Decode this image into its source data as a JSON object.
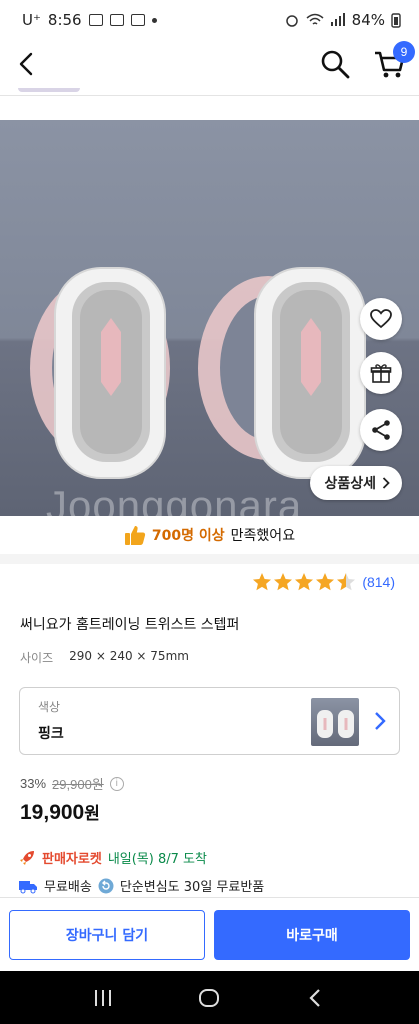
{
  "status_bar": {
    "carrier": "U⁺",
    "time": "8:56",
    "battery": "84%"
  },
  "nav": {
    "cart_count": "9"
  },
  "product_image": {
    "watermark": "Joonggonara",
    "detail_button": "상품상세"
  },
  "review_banner": {
    "highlight": "700명 이상",
    "text": "만족했어요"
  },
  "rating": {
    "stars": 4.5,
    "count": "(814)"
  },
  "product": {
    "title": "써니요가 홈트레이닝 트위스트 스텝퍼",
    "size_label": "사이즈",
    "size_value": "290 × 240 × 75mm"
  },
  "option": {
    "label": "색상",
    "value": "핑크"
  },
  "price": {
    "discount": "33%",
    "original": "29,900원",
    "sale": "19,900",
    "sale_unit": "원"
  },
  "delivery": {
    "rocket_label": "판매자로켓",
    "arrival": "내일(목) 8/7 도착",
    "free_shipping": "무료배송",
    "return_policy": "단순변심도 30일 무료반품"
  },
  "bottom_bar": {
    "add_to_cart": "장바구니 담기",
    "buy_now": "바로구매"
  },
  "colors": {
    "accent": "#346aff",
    "rocket": "#e44a2f",
    "arrival": "#0a8a4a",
    "star": "#f5a623"
  }
}
